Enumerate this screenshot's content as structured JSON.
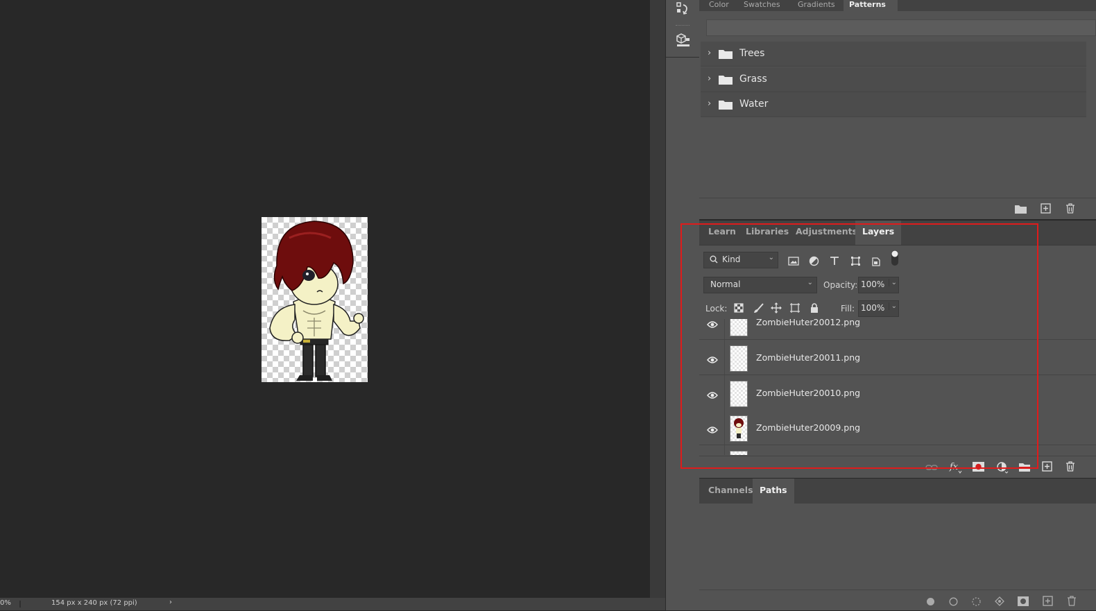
{
  "status_bar": {
    "zoom": "0%",
    "doc_info": "154 px x 240 px (72 ppi)",
    "chevron": "›"
  },
  "patterns_panel": {
    "tabs": [
      "Color",
      "Swatches",
      "Gradients",
      "Patterns"
    ],
    "folders": [
      {
        "label": "Trees"
      },
      {
        "label": "Grass"
      },
      {
        "label": "Water"
      }
    ]
  },
  "layers_panel": {
    "tabs": [
      {
        "label": "Learn",
        "active": false
      },
      {
        "label": "Libraries",
        "active": false
      },
      {
        "label": "Adjustments",
        "active": false
      },
      {
        "label": "Layers",
        "active": true
      }
    ],
    "filter": {
      "label": "Kind"
    },
    "blend_mode": "Normal",
    "opacity_label": "Opacity:",
    "opacity_value": "100%",
    "lock_label": "Lock:",
    "fill_label": "Fill:",
    "fill_value": "100%",
    "layers": [
      {
        "name": "ZombieHuter20012.png",
        "visible": true,
        "has_art": false
      },
      {
        "name": "ZombieHuter20011.png",
        "visible": true,
        "has_art": false
      },
      {
        "name": "ZombieHuter20010.png",
        "visible": true,
        "has_art": false
      },
      {
        "name": "ZombieHuter20009.png",
        "visible": true,
        "has_art": true
      }
    ]
  },
  "paths_panel": {
    "tabs": [
      {
        "label": "Channels",
        "active": false
      },
      {
        "label": "Paths",
        "active": true
      }
    ]
  },
  "colors": {
    "highlight": "#e01b1b",
    "panel_bg": "#535353",
    "canvas_bg": "#282828"
  }
}
